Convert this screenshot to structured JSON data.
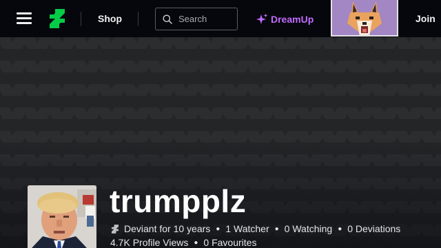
{
  "colors": {
    "topbar_bg": "#06070d",
    "page_bg": "#2b2c2e",
    "brand_green": "#05cc47",
    "dreamup_purple": "#c26cff",
    "text": "#f2f2f2"
  },
  "header": {
    "menu_icon": "hamburger-menu-icon",
    "logo_icon": "deviantart-logo-icon",
    "shop_label": "Shop",
    "search": {
      "placeholder": "Search",
      "value": "",
      "icon": "search-icon"
    },
    "dreamup": {
      "icon": "sparkle-icon",
      "label": "DreamUp"
    },
    "promo_thumbnail": "fox-avatar-image",
    "join_label": "Join"
  },
  "profile": {
    "avatar": "user-avatar-image",
    "username": "trumpplz",
    "tenure_icon": "deviantart-logo-icon",
    "tenure": "Deviant for 10 years",
    "watchers": "1 Watcher",
    "watching": "0 Watching",
    "deviations": "0 Deviations",
    "profile_views": "4.7K Profile Views",
    "favourites": "0 Favourites"
  }
}
